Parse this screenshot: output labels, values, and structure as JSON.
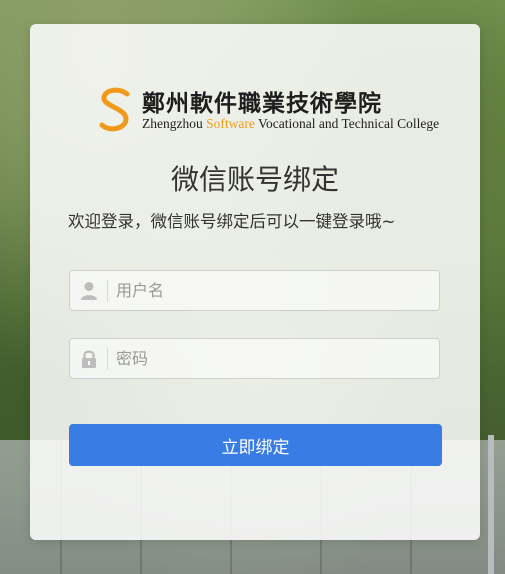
{
  "logo": {
    "mark": "S",
    "name_cn": "鄭州軟件職業技術學院",
    "name_en_prefix": "Zhengzhou ",
    "name_en_accent": "Software",
    "name_en_suffix": " Vocational and Technical College",
    "accent_color": "#f09a1b"
  },
  "page": {
    "title": "微信账号绑定",
    "subtitle": "欢迎登录，微信账号绑定后可以一键登录哦~"
  },
  "form": {
    "username": {
      "placeholder": "用户名",
      "value": "",
      "icon": "user-icon"
    },
    "password": {
      "placeholder": "密码",
      "value": "",
      "icon": "lock-icon"
    },
    "submit_label": "立即绑定",
    "submit_color": "#3a7ce6"
  }
}
